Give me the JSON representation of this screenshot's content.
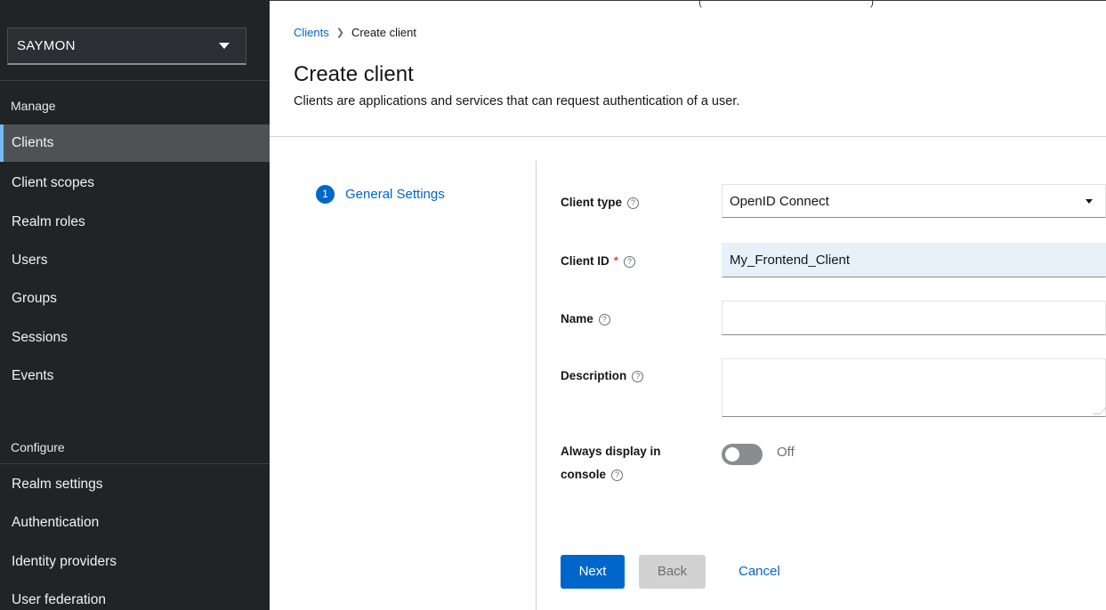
{
  "top_strip": {
    "open_paren": "(",
    "close_paren": ")"
  },
  "sidebar": {
    "realm": "SAYMON",
    "manage_heading": "Manage",
    "manage_items": [
      "Clients",
      "Client scopes",
      "Realm roles",
      "Users",
      "Groups",
      "Sessions",
      "Events"
    ],
    "active_item": "Clients",
    "configure_heading": "Configure",
    "configure_items": [
      "Realm settings",
      "Authentication",
      "Identity providers",
      "User federation"
    ]
  },
  "breadcrumb": {
    "parent": "Clients",
    "current": "Create client"
  },
  "page": {
    "title": "Create client",
    "description": "Clients are applications and services that can request authentication of a user."
  },
  "wizard": {
    "step_number": "1",
    "step_label": "General Settings"
  },
  "form": {
    "client_type_label": "Client type",
    "client_type_value": "OpenID Connect",
    "client_id_label": "Client ID",
    "client_id_required": "*",
    "client_id_value": "My_Frontend_Client",
    "name_label": "Name",
    "name_value": "",
    "description_label": "Description",
    "description_value": "",
    "always_display_label_line1": "Always display in",
    "always_display_label_line2": "console",
    "always_display_state": "Off",
    "help_glyph": "?"
  },
  "actions": {
    "next": "Next",
    "back": "Back",
    "cancel": "Cancel"
  },
  "colors": {
    "sidebar_bg": "#212427",
    "active_item_bg": "#4f5255",
    "active_accent": "#73bcf7",
    "primary": "#0066cc",
    "filled_input_bg": "#e7f1fa"
  },
  "icons": {
    "realm_dropdown": "caret-down-icon",
    "help": "help-circle-icon",
    "breadcrumb_separator": "chevron-right-icon"
  }
}
